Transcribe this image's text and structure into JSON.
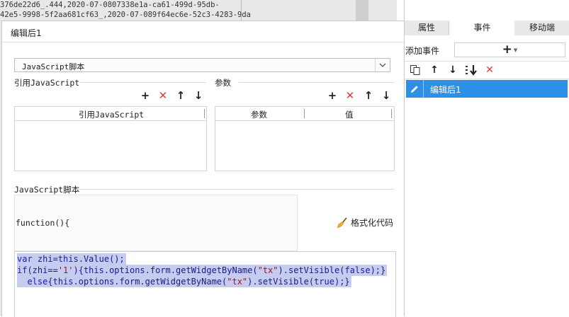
{
  "background": {
    "lines": [
      "376de22d6_.444,2020-07-0807338e1a-ca61-499d-95db-",
      "42e5-9998-5f2aa681cf63_,2020-07-089f64ec6e-52c3-4283-9da"
    ]
  },
  "dialog": {
    "title": "编辑后1",
    "script_type": "JavaScript脚本",
    "ref_section": {
      "label": "引用JavaScript",
      "columns": [
        "引用JavaScript"
      ]
    },
    "param_section": {
      "label": "参数",
      "columns": [
        "参数",
        "值"
      ]
    },
    "script_section": {
      "label": "JavaScript脚本",
      "function_header": "function(){",
      "format_button": "格式化代码"
    },
    "code": {
      "line1": [
        "var",
        " zhi=",
        "this",
        ".Value();"
      ],
      "line2": [
        "if",
        "(zhi==",
        "'1'",
        "){",
        "this",
        ".options.form.getWidgetByName(",
        "\"tx\"",
        ").setVisible(",
        "false",
        ");}"
      ],
      "line3": [
        "  ",
        "else",
        "{",
        "this",
        ".options.form.getWidgetByName(",
        "\"tx\"",
        ").setVisible(",
        "true",
        ");}"
      ]
    }
  },
  "right_panel": {
    "tabs": [
      "属性",
      "事件",
      "移动端"
    ],
    "active_tab": "事件",
    "add_event_label": "添加事件",
    "events": [
      {
        "label": "编辑后1",
        "selected": true
      }
    ]
  },
  "colors": {
    "selection_blue": "#2d8fe5",
    "delete_red": "#e23a3a",
    "code_highlight": "#c6cbf0",
    "keyword_blue": "#1a1ab5",
    "string_red": "#a31515"
  }
}
